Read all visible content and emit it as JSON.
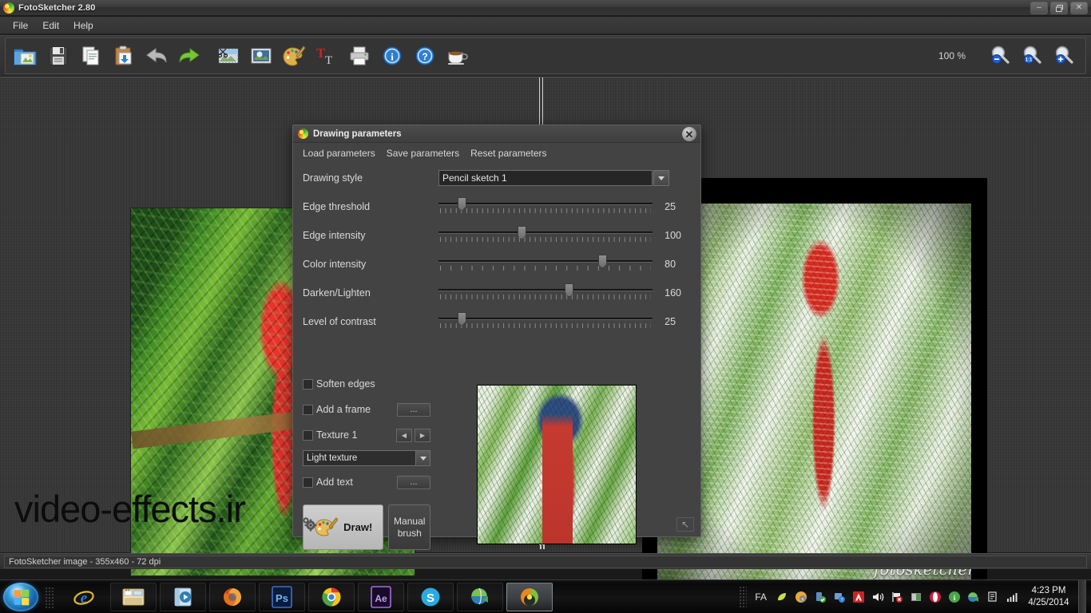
{
  "window": {
    "title": "FotoSketcher 2.80",
    "logo_icon": "fotosketcher-logo-icon",
    "minimize_label": "–",
    "restore_label": "❐",
    "close_label": "✕"
  },
  "menubar": {
    "items": [
      {
        "label": "File",
        "name": "menu-file"
      },
      {
        "label": "Edit",
        "name": "menu-edit"
      },
      {
        "label": "Help",
        "name": "menu-help"
      }
    ]
  },
  "toolbar": {
    "buttons": [
      {
        "name": "open-image-button",
        "icon": "folder-open-image-icon",
        "label": "Open"
      },
      {
        "name": "save-image-button",
        "icon": "floppy-disk-icon",
        "label": "Save"
      },
      {
        "name": "copy-button",
        "icon": "copy-pages-icon",
        "label": "Copy"
      },
      {
        "name": "paste-button",
        "icon": "clipboard-paste-icon",
        "label": "Paste"
      },
      {
        "name": "undo-button",
        "icon": "undo-arrow-icon",
        "label": "Undo"
      },
      {
        "name": "redo-button",
        "icon": "redo-arrow-icon",
        "label": "Redo"
      },
      {
        "name": "crop-button",
        "icon": "scissors-crop-icon",
        "label": "Crop"
      },
      {
        "name": "resize-button",
        "icon": "picture-resize-icon",
        "label": "Resize"
      },
      {
        "name": "drawing-parameters-button",
        "icon": "palette-icon",
        "label": "Drawing parameters"
      },
      {
        "name": "add-text-button",
        "icon": "text-tool-icon",
        "label": "Add text"
      },
      {
        "name": "print-button",
        "icon": "printer-icon",
        "label": "Print"
      },
      {
        "name": "info-button",
        "icon": "info-circle-icon",
        "label": "Info"
      },
      {
        "name": "help-button",
        "icon": "question-circle-icon",
        "label": "Help"
      },
      {
        "name": "donate-button",
        "icon": "coffee-cup-icon",
        "label": "Donate"
      }
    ],
    "zoom_percent": "100 %",
    "zoom_buttons": [
      {
        "name": "zoom-out-button",
        "icon": "magnifier-minus-icon",
        "glyph": "−"
      },
      {
        "name": "zoom-actual-size-button",
        "icon": "magnifier-one-to-one-icon",
        "glyph": "1:1"
      },
      {
        "name": "zoom-in-button",
        "icon": "magnifier-plus-icon",
        "glyph": "+"
      }
    ]
  },
  "workspace": {
    "original_image_name": "original-photo-macaw",
    "result_image_name": "sketch-result-macaw",
    "signature": "fotosketcher",
    "watermark": "video-effects.ir"
  },
  "dialog": {
    "title": "Drawing parameters",
    "logo_icon": "fotosketcher-logo-icon",
    "close_label": "✕",
    "menu": [
      {
        "label": "Load parameters",
        "name": "load-parameters-menu"
      },
      {
        "label": "Save parameters",
        "name": "save-parameters-menu"
      },
      {
        "label": "Reset parameters",
        "name": "reset-parameters-menu"
      }
    ],
    "drawing_style": {
      "label": "Drawing style",
      "value": "Pencil sketch 1"
    },
    "sliders": [
      {
        "label": "Edge threshold",
        "value": "25",
        "percent": 11
      },
      {
        "label": "Edge intensity",
        "value": "100",
        "percent": 40
      },
      {
        "label": "Color intensity",
        "value": "80",
        "percent": 79,
        "sparse_ticks": true
      },
      {
        "label": "Darken/Lighten",
        "value": "160",
        "percent": 63
      },
      {
        "label": "Level of contrast",
        "value": "25",
        "percent": 11
      }
    ],
    "checkboxes": [
      {
        "label": "Soften edges",
        "checked": false,
        "name": "soften-edges-checkbox",
        "button": null
      },
      {
        "label": "Add a frame",
        "checked": false,
        "name": "add-frame-checkbox",
        "button": "..."
      },
      {
        "label": "Texture 1",
        "checked": false,
        "name": "texture-checkbox",
        "button": null
      },
      {
        "label": "Add text",
        "checked": false,
        "name": "add-text-checkbox",
        "button": "..."
      }
    ],
    "texture_select": {
      "value": "Light texture"
    },
    "spin_prev": "◀",
    "spin_next": "▶",
    "draw_button": "Draw!",
    "manual_brush_line1": "Manual",
    "manual_brush_line2": "brush",
    "preview_name": "drawing-preview-thumbnail",
    "gear_icon": "settings-gear-icon",
    "resize_grip": "↖"
  },
  "statusbar": {
    "text": "FotoSketcher image - 355x460 - 72 dpi"
  },
  "taskbar": {
    "start_label": "Start",
    "tasks": [
      {
        "name": "taskbar-internet-explorer",
        "icon": "internet-explorer-icon",
        "active": false
      },
      {
        "name": "taskbar-file-explorer",
        "icon": "windows-explorer-icon",
        "active": false
      },
      {
        "name": "taskbar-media-player",
        "icon": "media-player-icon",
        "active": false
      },
      {
        "name": "taskbar-firefox",
        "icon": "firefox-icon",
        "active": false
      },
      {
        "name": "taskbar-photoshop",
        "icon": "photoshop-icon",
        "active": false,
        "text": "Ps"
      },
      {
        "name": "taskbar-chrome",
        "icon": "chrome-icon",
        "active": false
      },
      {
        "name": "taskbar-after-effects",
        "icon": "after-effects-icon",
        "active": false,
        "text": "Ae"
      },
      {
        "name": "taskbar-skype",
        "icon": "skype-icon",
        "active": false,
        "text": "S"
      },
      {
        "name": "taskbar-download-manager",
        "icon": "idm-globe-icon",
        "active": false
      },
      {
        "name": "taskbar-fotosketcher",
        "icon": "fotosketcher-logo-icon",
        "active": true
      }
    ],
    "tray": {
      "language": "FA",
      "icons": [
        {
          "name": "tray-leaf-icon"
        },
        {
          "name": "tray-antivirus-icon"
        },
        {
          "name": "tray-usb-safely-remove-icon"
        },
        {
          "name": "tray-network-icon"
        },
        {
          "name": "tray-adobe-icon"
        },
        {
          "name": "tray-volume-icon"
        },
        {
          "name": "tray-flag-action-center-icon"
        },
        {
          "name": "tray-display-icon"
        },
        {
          "name": "tray-opera-icon"
        },
        {
          "name": "tray-info-icon"
        },
        {
          "name": "tray-idm-icon"
        },
        {
          "name": "tray-printer-icon"
        },
        {
          "name": "tray-signal-icon"
        }
      ],
      "time": "4:23 PM",
      "date": "4/25/2014"
    }
  }
}
